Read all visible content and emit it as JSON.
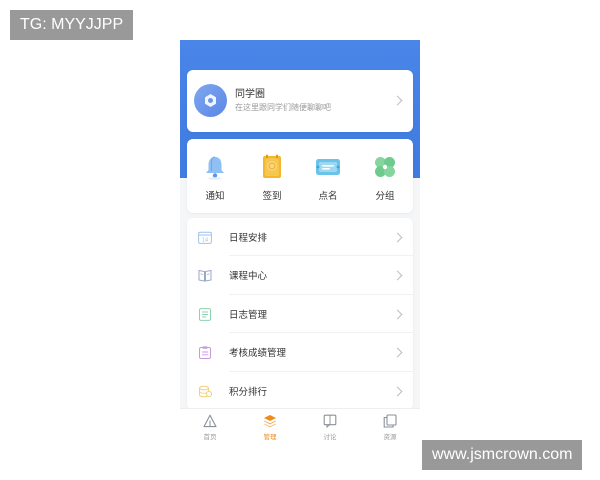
{
  "watermarks": {
    "top_left": "TG: MYYJJPP",
    "bottom_right": "www.jsmcrown.com"
  },
  "circle": {
    "title": "同学圈",
    "subtitle": "在这里跟同学们随便聊聊吧",
    "icon": "hexagon-icon"
  },
  "actions": [
    {
      "label": "通知",
      "icon": "bell-icon",
      "color": "#7fb5f2"
    },
    {
      "label": "签到",
      "icon": "sign-in-icon",
      "color": "#f5b629"
    },
    {
      "label": "点名",
      "icon": "roll-call-icon",
      "color": "#6cc3ea"
    },
    {
      "label": "分组",
      "icon": "clover-icon",
      "color": "#7fd39a"
    }
  ],
  "menu": [
    {
      "label": "日程安排",
      "icon": "calendar-icon",
      "color": "#9cc3ea"
    },
    {
      "label": "课程中心",
      "icon": "book-icon",
      "color": "#9aa8c8"
    },
    {
      "label": "日志管理",
      "icon": "log-icon",
      "color": "#8ed3b0"
    },
    {
      "label": "考核成绩管理",
      "icon": "clipboard-icon",
      "color": "#c79ae0"
    },
    {
      "label": "积分排行",
      "icon": "coins-icon",
      "color": "#f2d27a"
    }
  ],
  "tabs": [
    {
      "label": "首页",
      "icon": "home-triangle-icon",
      "active": false
    },
    {
      "label": "管理",
      "icon": "layers-icon",
      "active": true
    },
    {
      "label": "讨论",
      "icon": "book-open-icon",
      "active": false
    },
    {
      "label": "资源",
      "icon": "copy-icon",
      "active": false
    }
  ],
  "colors": {
    "header_blue": "#4a86e8",
    "active_tab": "#f28b1b",
    "watermark_bg": "#999999"
  }
}
